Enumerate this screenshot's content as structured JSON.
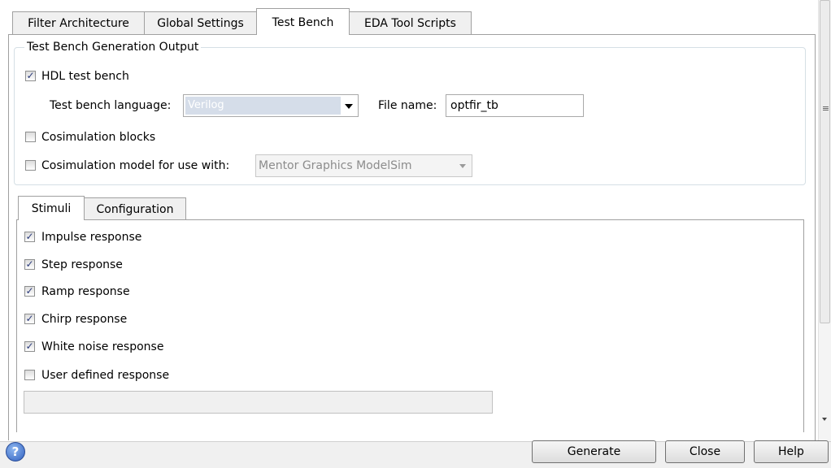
{
  "tabs": [
    {
      "label": "Filter Architecture"
    },
    {
      "label": "Global Settings"
    },
    {
      "label": "Test Bench"
    },
    {
      "label": "EDA Tool Scripts"
    }
  ],
  "output_group": {
    "title": "Test Bench Generation Output",
    "hdl_test_bench": {
      "label": "HDL test bench",
      "checked": true
    },
    "language": {
      "label": "Test bench language:",
      "value": "Verilog"
    },
    "file_name": {
      "label": "File name:",
      "value": "optfir_tb"
    },
    "cosim_blocks": {
      "label": "Cosimulation blocks",
      "checked": false
    },
    "cosim_model": {
      "label": "Cosimulation model for use with:",
      "checked": false,
      "value": "Mentor Graphics ModelSim"
    }
  },
  "subtabs": [
    {
      "label": "Stimuli"
    },
    {
      "label": "Configuration"
    }
  ],
  "stimuli": [
    {
      "label": "Impulse response",
      "checked": true
    },
    {
      "label": "Step response",
      "checked": true
    },
    {
      "label": "Ramp response",
      "checked": true
    },
    {
      "label": "Chirp response",
      "checked": true
    },
    {
      "label": "White noise response",
      "checked": true
    },
    {
      "label": "User defined response",
      "checked": false
    }
  ],
  "user_defined_value": "",
  "buttons": {
    "generate": "Generate",
    "close": "Close",
    "help": "Help"
  },
  "icons": {
    "check": "✓",
    "scroll_grip": "≡",
    "help": "?"
  }
}
